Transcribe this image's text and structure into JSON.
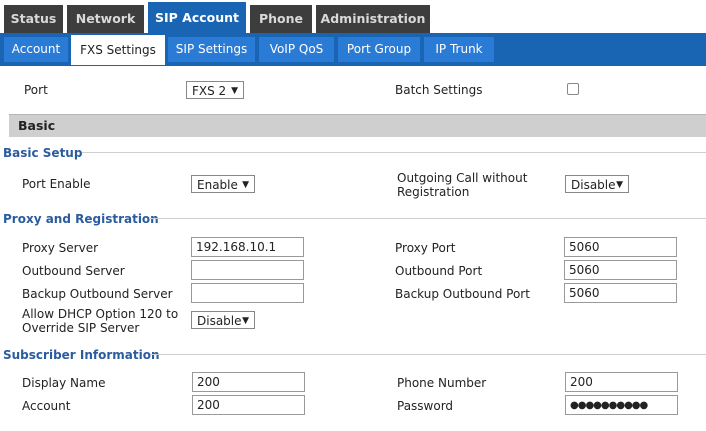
{
  "top_tabs": [
    "Status",
    "Network",
    "SIP Account",
    "Phone",
    "Administration"
  ],
  "sub_tabs": [
    "Account",
    "FXS Settings",
    "SIP Settings",
    "VoIP QoS",
    "Port Group",
    "IP Trunk"
  ],
  "port": {
    "label": "Port",
    "value": "FXS 2"
  },
  "batch_settings": {
    "label": "Batch Settings",
    "checked": false
  },
  "basic_header": "Basic",
  "basic_setup": {
    "title": "Basic Setup",
    "port_enable_label": "Port Enable",
    "port_enable_value": "Enable",
    "outgoing_label": "Outgoing Call without Registration",
    "outgoing_value": "Disable"
  },
  "proxy": {
    "title": "Proxy and Registration",
    "proxy_server_label": "Proxy Server",
    "proxy_server_value": "192.168.10.1",
    "proxy_port_label": "Proxy Port",
    "proxy_port_value": "5060",
    "outbound_server_label": "Outbound Server",
    "outbound_server_value": "",
    "outbound_port_label": "Outbound Port",
    "outbound_port_value": "5060",
    "backup_server_label": "Backup Outbound Server",
    "backup_server_value": "",
    "backup_port_label": "Backup Outbound Port",
    "backup_port_value": "5060",
    "dhcp_label": "Allow DHCP Option 120 to Override SIP Server",
    "dhcp_value": "Disable"
  },
  "subscriber": {
    "title": "Subscriber Information",
    "display_name_label": "Display Name",
    "display_name_value": "200",
    "phone_number_label": "Phone Number",
    "phone_number_value": "200",
    "account_label": "Account",
    "account_value": "200",
    "password_label": "Password",
    "password_value": "●●●●●●●●●●"
  },
  "colors": {
    "top_bar": "#3d3d3d",
    "accent_blue": "#1a64b4",
    "sub_tab": "#2a7bd6",
    "section_title": "#2a5c9e",
    "basic_bar": "#cfcfcf"
  }
}
